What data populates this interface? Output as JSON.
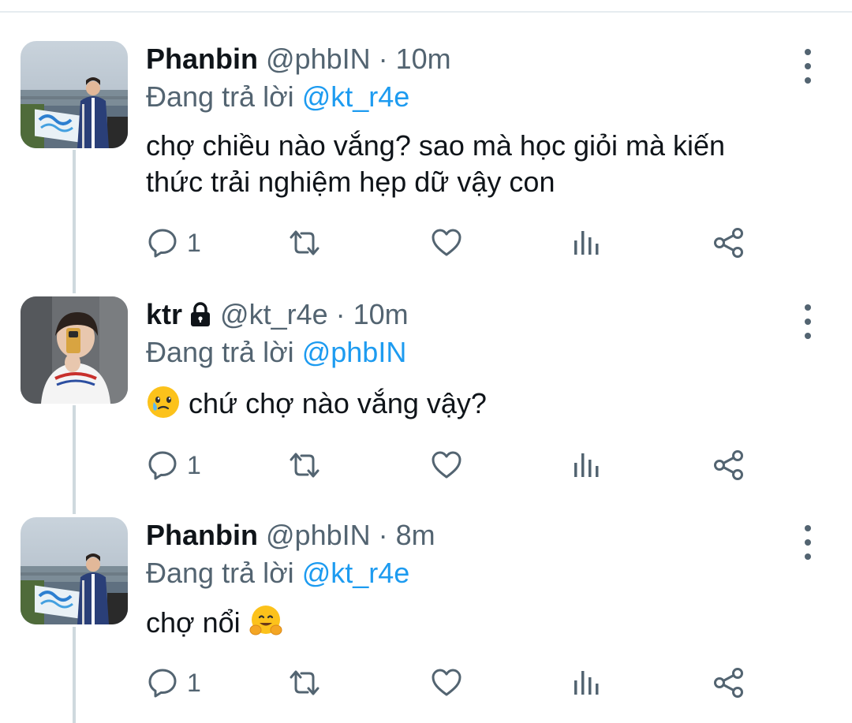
{
  "tweets": [
    {
      "name": "Phanbin",
      "handle": "@phbIN",
      "dot": "·",
      "time": "10m",
      "reply_prefix": "Đang trả lời",
      "reply_to": "@kt_r4e",
      "text_line1": "chợ chiều nào vắng? sao mà học giỏi mà kiến",
      "text_line2": "thức trải nghiệm hẹp dữ vậy con",
      "reply_count": "1",
      "locked": false,
      "avatar": "river-photo-avatar"
    },
    {
      "name": "ktr",
      "handle": "@kt_r4e",
      "dot": "·",
      "time": "10m",
      "reply_prefix": "Đang trả lời",
      "reply_to": "@phbIN",
      "text": "chứ chợ nào vắng vậy?",
      "emoji": "face-holding-back-tears",
      "reply_count": "1",
      "locked": true,
      "avatar": "mirror-selfie-avatar"
    },
    {
      "name": "Phanbin",
      "handle": "@phbIN",
      "dot": "·",
      "time": "8m",
      "reply_prefix": "Đang trả lời",
      "reply_to": "@kt_r4e",
      "text": "chợ nổi",
      "emoji": "hugging-face",
      "reply_count": "1",
      "locked": false,
      "avatar": "river-photo-avatar"
    }
  ],
  "icons": {
    "reply": "reply-icon",
    "retweet": "retweet-icon",
    "like": "heart-icon",
    "analytics": "analytics-icon",
    "share": "share-icon",
    "more": "more-vertical-icon",
    "lock": "lock-icon"
  },
  "colors": {
    "mention": "#1d9bf0",
    "secondary_text": "#536471",
    "primary_text": "#0f1419",
    "thread_line": "#cfd9de"
  }
}
